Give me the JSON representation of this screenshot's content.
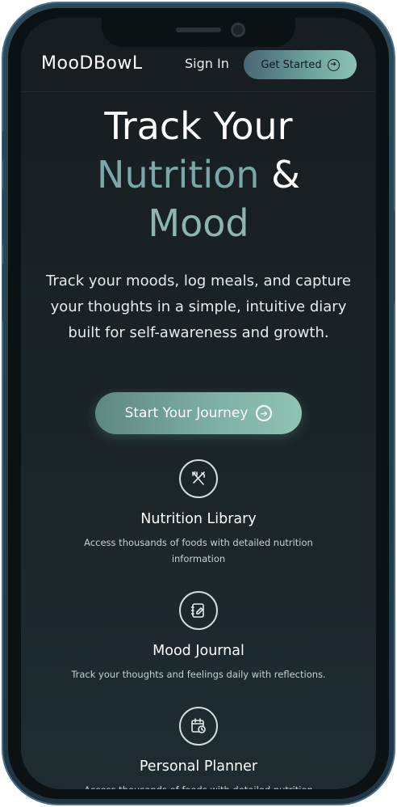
{
  "header": {
    "logo": "MooDBowL",
    "sign_in": "Sign In",
    "get_started": "Get Started"
  },
  "hero": {
    "line1": "Track Your",
    "line2_accent": "Nutrition",
    "line2_rest": "&",
    "line3_accent": "Mood",
    "subtitle": "Track your moods, log meals, and capture your thoughts in a simple, intuitive diary built for self-awareness and growth.",
    "cta": "Start Your Journey"
  },
  "features": [
    {
      "icon": "utensils-icon",
      "title": "Nutrition Library",
      "description": "Access thousands of foods with detailed nutrition information"
    },
    {
      "icon": "journal-pen-icon",
      "title": "Mood Journal",
      "description": "Track your thoughts and feelings daily with reflections."
    },
    {
      "icon": "calendar-clock-icon",
      "title": "Personal Planner",
      "description": "Access thousands of foods with detailed nutrition"
    }
  ],
  "colors": {
    "accent": "#7aa8a8",
    "button_gradient_start": "#486674",
    "button_gradient_end": "#8bc3b2",
    "background": "#1a2327"
  }
}
